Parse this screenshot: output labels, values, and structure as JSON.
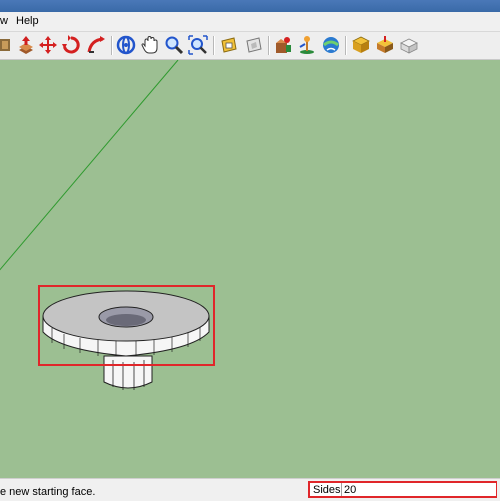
{
  "menubar": {
    "items": [
      {
        "label": "w"
      },
      {
        "label": "Help"
      }
    ]
  },
  "toolbar": {
    "tools": [
      {
        "icon": "components-icon"
      },
      {
        "icon": "push-pull-icon"
      },
      {
        "icon": "move-icon"
      },
      {
        "icon": "rotate-icon"
      },
      {
        "icon": "follow-me-icon"
      },
      {
        "icon": "orbit-icon"
      },
      {
        "icon": "pan-icon"
      },
      {
        "icon": "zoom-icon"
      },
      {
        "icon": "zoom-extents-icon"
      },
      {
        "icon": "get-models-icon"
      },
      {
        "icon": "share-model-icon"
      },
      {
        "icon": "get-photo-texture-icon"
      },
      {
        "icon": "position-camera-icon"
      },
      {
        "icon": "walk-icon"
      },
      {
        "icon": "look-around-icon"
      },
      {
        "icon": "add-location-icon"
      },
      {
        "icon": "toggle-terrain-icon"
      },
      {
        "icon": "photo-textures-icon"
      }
    ]
  },
  "status": {
    "text": "e new starting face."
  },
  "measurements": {
    "label": "Sides",
    "value": "20"
  },
  "colors": {
    "viewport_background": "#9cbf92",
    "highlight_box": "#e0262a",
    "green_axis": "#2f9a2f"
  }
}
